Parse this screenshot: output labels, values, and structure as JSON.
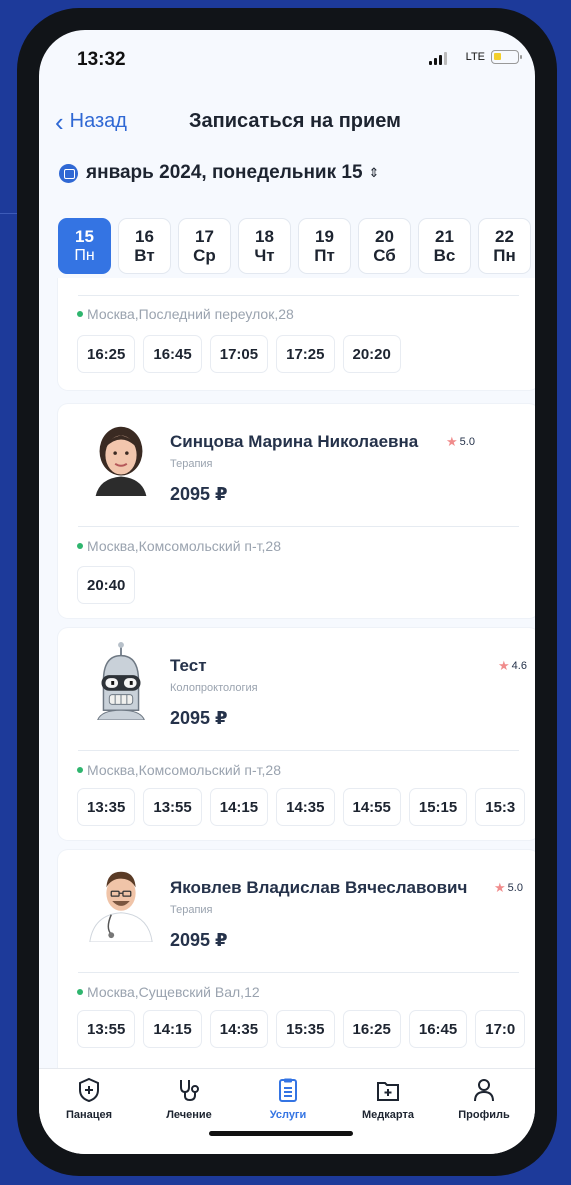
{
  "status": {
    "time": "13:32",
    "network": "LTE"
  },
  "nav": {
    "back_label": "Назад",
    "title": "Записаться на прием"
  },
  "date_selector": {
    "label": "январь 2024, понедельник 15"
  },
  "days": [
    {
      "num": "15",
      "dow": "Пн",
      "selected": true
    },
    {
      "num": "16",
      "dow": "Вт"
    },
    {
      "num": "17",
      "dow": "Ср"
    },
    {
      "num": "18",
      "dow": "Чт"
    },
    {
      "num": "19",
      "dow": "Пт"
    },
    {
      "num": "20",
      "dow": "Сб"
    },
    {
      "num": "21",
      "dow": "Вс"
    },
    {
      "num": "22",
      "dow": "Пн"
    }
  ],
  "doctors": [
    {
      "address": "Москва,Последний переулок,28",
      "slots": [
        "16:25",
        "16:45",
        "17:05",
        "17:25",
        "20:20"
      ]
    },
    {
      "name": "Синцова Марина Николаевна",
      "rating": "5.0",
      "specialty": "Терапия",
      "price": "2095 ₽",
      "address": "Москва,Комсомольский п-т,28",
      "slots": [
        "20:40"
      ]
    },
    {
      "name": "Тест",
      "rating": "4.6",
      "specialty": "Колопроктология",
      "price": "2095 ₽",
      "address": "Москва,Комсомольский п-т,28",
      "slots": [
        "13:35",
        "13:55",
        "14:15",
        "14:35",
        "14:55",
        "15:15",
        "15:3"
      ]
    },
    {
      "name": "Яковлев Владислав Вячеславович",
      "rating": "5.0",
      "specialty": "Терапия",
      "price": "2095 ₽",
      "address": "Москва,Сущевский Вал,12",
      "slots": [
        "13:55",
        "14:15",
        "14:35",
        "15:35",
        "16:25",
        "16:45",
        "17:0"
      ]
    }
  ],
  "tabs": [
    {
      "label": "Панацея",
      "icon": "shield-plus-icon"
    },
    {
      "label": "Лечение",
      "icon": "stethoscope-icon"
    },
    {
      "label": "Услуги",
      "icon": "clipboard-list-icon",
      "active": true
    },
    {
      "label": "Медкарта",
      "icon": "medical-folder-icon"
    },
    {
      "label": "Профиль",
      "icon": "person-icon"
    }
  ],
  "colors": {
    "accent": "#3474e3",
    "background": "#1d3a9a",
    "rating_star": "#f08c8c",
    "address_dot": "#2fb56e"
  }
}
